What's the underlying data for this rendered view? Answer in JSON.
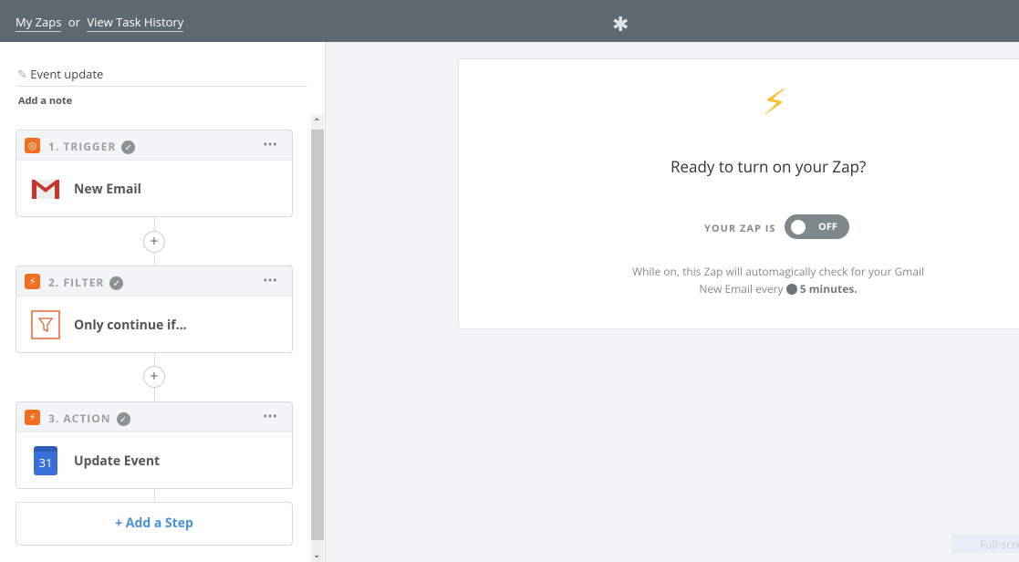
{
  "topbar": {
    "my_zaps": "My Zaps",
    "or": "or",
    "history": "View Task History",
    "logo_icon": "zapier-asterisk-icon"
  },
  "editor": {
    "title": "Event update",
    "add_note": "Add a note"
  },
  "steps": [
    {
      "label": "1. TRIGGER",
      "app": "New Email",
      "icon": "gmail-icon"
    },
    {
      "label": "2. FILTER",
      "app": "Only continue if...",
      "icon": "filter-icon"
    },
    {
      "label": "3. ACTION",
      "app": "Update Event",
      "icon": "google-calendar-icon",
      "calendar_day": "31"
    }
  ],
  "add_step": "+ Add a Step",
  "panel": {
    "heading": "Ready to turn on your Zap?",
    "your_zap_is": "YOUR ZAP IS",
    "toggle_state": "OFF",
    "desc_line1": "While on, this Zap will automagically check for your Gmail",
    "desc_line2": "New Email every",
    "interval": "5 minutes."
  },
  "fullscreen": "Full-screen",
  "colors": {
    "topbar": "#5f6a70",
    "accent": "#f26e21",
    "link": "#4a90d9",
    "bolt": "#f8c02c"
  }
}
